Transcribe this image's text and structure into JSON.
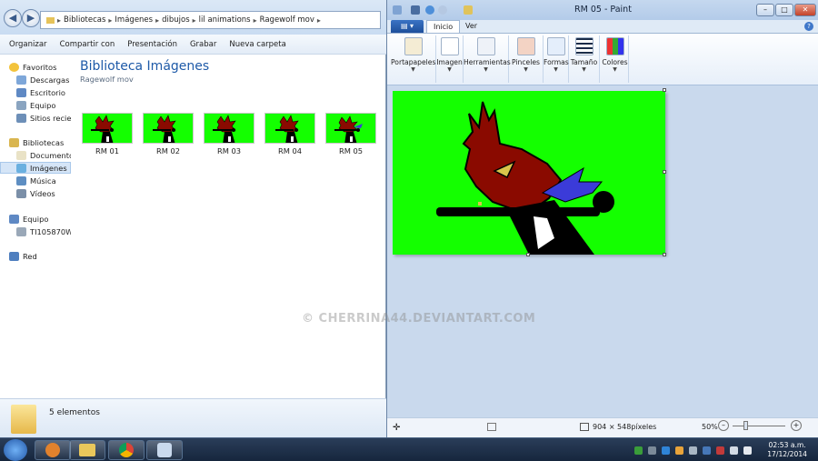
{
  "explorer": {
    "breadcrumb": [
      "Bibliotecas",
      "Imágenes",
      "dibujos",
      "lil animations",
      "Ragewolf mov"
    ],
    "toolbar": {
      "organize": "Organizar",
      "share": "Compartir con",
      "slideshow": "Presentación",
      "burn": "Grabar",
      "new_folder": "Nueva carpeta"
    },
    "sidebar": {
      "favorites": "Favoritos",
      "downloads": "Descargas",
      "desktop": "Escritorio",
      "computer_fav": "Equipo",
      "recent": "Sitios recientes",
      "libraries": "Bibliotecas",
      "documents": "Documentos",
      "images": "Imágenes",
      "music": "Música",
      "videos": "Vídeos",
      "computer": "Equipo",
      "disk": "TI105870W0",
      "network": "Red"
    },
    "library_title": "Biblioteca Imágenes",
    "library_subtitle": "Ragewolf mov",
    "files": [
      "RM 01",
      "RM 02",
      "RM 03",
      "RM 04",
      "RM 05"
    ],
    "item_count": "5 elementos"
  },
  "paint": {
    "title": "RM 05 - Paint",
    "tabs": {
      "home": "Inicio",
      "view": "Ver"
    },
    "ribbon": {
      "clipboard": "Portapapeles",
      "image": "Imagen",
      "tools": "Herramientas",
      "brushes": "Pinceles",
      "shapes": "Formas",
      "size": "Tamaño",
      "colors": "Colores"
    },
    "status": {
      "dimensions": "904 × 548píxeles",
      "zoom": "50%"
    },
    "canvas_color": "#14ff00"
  },
  "taskbar": {
    "time": "02:53 a.m.",
    "date": "17/12/2014"
  },
  "watermark": "© CHERRINA44.DEVIANTART.COM"
}
